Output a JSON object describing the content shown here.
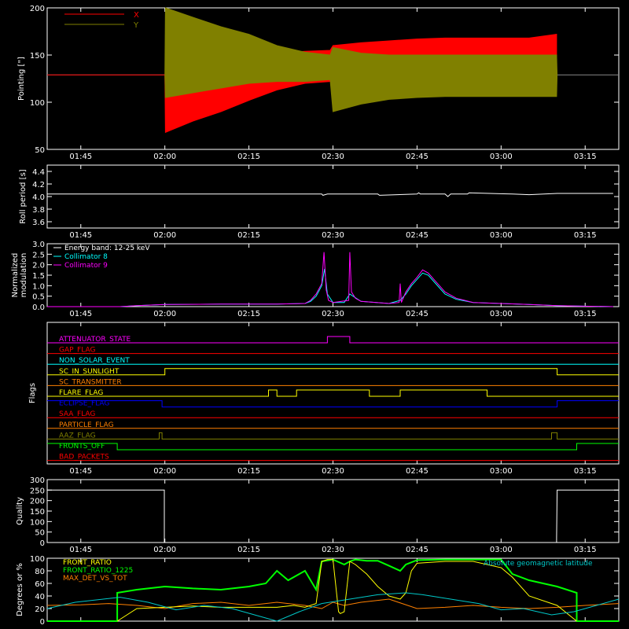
{
  "time_axis": {
    "ticks": [
      "01:45",
      "02:00",
      "02:15",
      "02:30",
      "02:45",
      "03:00",
      "03:15"
    ],
    "tick_minutes": [
      105,
      120,
      135,
      150,
      165,
      180,
      195
    ],
    "range_minutes": [
      99,
      201
    ]
  },
  "chart_data": [
    {
      "type": "area",
      "ylabel": "Pointing [\"]",
      "ylim": [
        50,
        200
      ],
      "yticks": [
        50,
        100,
        150,
        200
      ],
      "legend": {
        "placement": "top-left",
        "entries": [
          "X",
          "Y"
        ]
      },
      "series": [
        {
          "name": "X",
          "color": "#ff0000",
          "x": [
            99,
            120,
            120.1,
            125,
            130,
            135,
            140,
            145,
            149.5,
            150,
            155,
            160,
            165,
            170,
            175,
            180,
            185,
            189.9
          ],
          "min": [
            129,
            129,
            68,
            80,
            90,
            102,
            113,
            120,
            122,
            130,
            145,
            147,
            147,
            147,
            147,
            147,
            147,
            147
          ],
          "max": [
            129,
            129,
            128,
            135,
            142,
            148,
            152,
            154,
            155,
            160,
            163,
            165,
            167,
            168,
            168,
            168,
            168,
            172
          ]
        },
        {
          "name": "Y",
          "color": "#808000",
          "x": [
            120,
            120.1,
            125,
            130,
            135,
            140,
            145,
            149.5,
            150,
            155,
            160,
            165,
            170,
            175,
            180,
            185,
            189.9,
            190
          ],
          "min": [
            129,
            105,
            110,
            115,
            120,
            122,
            122,
            124,
            90,
            98,
            103,
            105,
            106,
            106,
            106,
            106,
            106,
            129
          ],
          "max": [
            129,
            200,
            190,
            180,
            172,
            160,
            153,
            150,
            158,
            152,
            150,
            150,
            150,
            150,
            150,
            150,
            150,
            129
          ]
        }
      ],
      "baseline": {
        "value": 129,
        "color": "#888888"
      }
    },
    {
      "type": "line",
      "ylabel": "Roll period [s]",
      "ylim": [
        3.5,
        4.5
      ],
      "yticks": [
        3.6,
        3.8,
        4.0,
        4.2,
        4.4
      ],
      "series": [
        {
          "color": "#ffffff",
          "x": [
            99,
            148,
            148.2,
            149,
            151,
            158,
            158.3,
            165,
            165.3,
            165.6,
            170,
            170.5,
            171,
            174,
            174.3,
            182,
            185,
            190,
            200
          ],
          "y": [
            4.04,
            4.04,
            4.02,
            4.04,
            4.04,
            4.04,
            4.02,
            4.04,
            4.06,
            4.04,
            4.04,
            4.0,
            4.04,
            4.04,
            4.06,
            4.04,
            4.03,
            4.05,
            4.05
          ]
        }
      ]
    },
    {
      "type": "line",
      "ylabel": "Normalized modulation",
      "ylim": [
        0,
        3.0
      ],
      "yticks": [
        0.0,
        0.5,
        1.0,
        1.5,
        2.0,
        2.5,
        3.0
      ],
      "legend": {
        "placement": "top-left",
        "entries": [
          "Energy band: 12-25 keV",
          "Collimator 8",
          "Collimator 9"
        ]
      },
      "series": [
        {
          "name": "Collimator 8",
          "color": "#00ffff",
          "x": [
            99,
            112,
            115,
            120,
            130,
            140,
            145,
            146,
            147,
            148,
            148.5,
            149,
            150,
            152,
            153,
            155,
            160,
            162,
            163,
            164,
            165,
            166,
            167,
            168,
            169,
            170,
            172,
            175,
            180,
            185,
            190,
            200
          ],
          "y": [
            0,
            0,
            0.05,
            0.1,
            0.12,
            0.12,
            0.15,
            0.25,
            0.5,
            1.0,
            1.8,
            0.6,
            0.2,
            0.2,
            0.6,
            0.25,
            0.15,
            0.3,
            0.6,
            1.0,
            1.3,
            1.6,
            1.5,
            1.2,
            0.9,
            0.6,
            0.35,
            0.2,
            0.15,
            0.1,
            0.05,
            0
          ]
        },
        {
          "name": "Collimator 9",
          "color": "#ff00ff",
          "x": [
            99,
            112,
            115,
            120,
            130,
            140,
            145,
            146,
            147,
            148,
            148.4,
            148.8,
            149.2,
            150,
            152.8,
            153,
            153.3,
            154,
            155,
            160,
            161.8,
            162,
            162.2,
            163,
            164,
            165,
            166,
            167,
            168,
            169,
            170,
            172,
            175,
            180,
            185,
            190,
            200
          ],
          "y": [
            0,
            0,
            0.05,
            0.1,
            0.12,
            0.12,
            0.15,
            0.3,
            0.6,
            1.1,
            2.6,
            0.8,
            0.3,
            0.2,
            0.3,
            2.6,
            0.7,
            0.4,
            0.25,
            0.15,
            0.2,
            1.1,
            0.2,
            0.7,
            1.1,
            1.4,
            1.75,
            1.6,
            1.3,
            1.0,
            0.7,
            0.4,
            0.2,
            0.15,
            0.1,
            0.05,
            0
          ]
        }
      ]
    },
    {
      "type": "line",
      "ylabel": "Flags",
      "series": [
        {
          "name": "ATTENUATOR_STATE",
          "color": "#ff00ff",
          "x": [
            99,
            149,
            149,
            153,
            153,
            201
          ],
          "y": [
            0,
            0,
            1,
            1,
            0,
            0
          ]
        },
        {
          "name": "GAP_FLAG",
          "color": "#ff0000",
          "x": [
            99,
            201
          ],
          "y": [
            0,
            0
          ]
        },
        {
          "name": "NON_SOLAR_EVENT",
          "color": "#00ffff",
          "x": [
            99,
            201
          ],
          "y": [
            0,
            0
          ]
        },
        {
          "name": "SC_IN_SUNLIGHT",
          "color": "#ffff00",
          "x": [
            99,
            120,
            120,
            190,
            190,
            201
          ],
          "y": [
            0,
            0,
            1,
            1,
            0,
            0
          ]
        },
        {
          "name": "SC_TRANSMITTER",
          "color": "#ff8000",
          "x": [
            99,
            201
          ],
          "y": [
            0,
            0
          ]
        },
        {
          "name": "FLARE_FLAG",
          "color": "#ffff00",
          "x": [
            99,
            138.5,
            138.5,
            140,
            140,
            143.5,
            143.5,
            156.5,
            156.5,
            162,
            162,
            177.5,
            177.5,
            201
          ],
          "y": [
            0,
            0,
            1,
            1,
            0,
            0,
            1,
            1,
            0,
            0,
            1,
            1,
            0,
            0
          ]
        },
        {
          "name": "ECLIPSE_FLAG",
          "color": "#0000ff",
          "x": [
            99,
            119.5,
            119.5,
            190,
            190,
            201
          ],
          "y": [
            1,
            1,
            0,
            0,
            1,
            1
          ]
        },
        {
          "name": "SAA_FLAG",
          "color": "#ff0000",
          "x": [
            99,
            201
          ],
          "y": [
            0,
            0
          ]
        },
        {
          "name": "PARTICLE_FLAG",
          "color": "#ff8000",
          "x": [
            99,
            201
          ],
          "y": [
            0,
            0
          ]
        },
        {
          "name": "AAZ_FLAG",
          "color": "#808000",
          "x": [
            99,
            119,
            119,
            119.5,
            119.5,
            189,
            189,
            190,
            190,
            201
          ],
          "y": [
            0,
            0,
            1,
            1,
            0,
            0,
            1,
            1,
            0,
            0
          ]
        },
        {
          "name": "FRONTS_OFF",
          "color": "#00ff00",
          "x": [
            99,
            111.5,
            111.5,
            193.5,
            193.5,
            201
          ],
          "y": [
            1,
            1,
            0,
            0,
            1,
            1
          ]
        },
        {
          "name": "BAD_PACKETS",
          "color": "#ff0000",
          "x": [
            99,
            201
          ],
          "y": [
            0,
            0
          ]
        }
      ]
    },
    {
      "type": "line",
      "ylabel": "Quality",
      "ylim": [
        0,
        300
      ],
      "yticks": [
        0,
        50,
        100,
        150,
        200,
        250,
        300
      ],
      "series": [
        {
          "color": "#ffffff",
          "x": [
            99,
            119.9,
            119.9,
            120,
            189.9,
            189.9,
            190,
            201
          ],
          "y": [
            250,
            250,
            0,
            0,
            0,
            20,
            250,
            250
          ]
        }
      ]
    },
    {
      "type": "line",
      "ylabel": "Degrees or %",
      "ylim": [
        0,
        100
      ],
      "yticks": [
        0,
        20,
        40,
        60,
        80,
        100
      ],
      "legend": {
        "placement": "top",
        "entries": [
          "FRONT_RATIO",
          "FRONT_RATIO_1225",
          "MAX_DET_VS_TOT",
          "Absolute geomagnetic latitude"
        ]
      },
      "series": [
        {
          "name": "FRONT_RATIO",
          "color": "#ffff00",
          "x": [
            111.5,
            115,
            120,
            125,
            130,
            135,
            140,
            143,
            145,
            147,
            148,
            149,
            150,
            151,
            151.3,
            152,
            153,
            154,
            156,
            158,
            160,
            162,
            163,
            164,
            165,
            170,
            175,
            180,
            182,
            185,
            190,
            193.5
          ],
          "y": [
            0,
            20,
            22,
            24,
            22,
            22,
            22,
            25,
            22,
            28,
            95,
            98,
            98,
            15,
            12,
            15,
            95,
            90,
            75,
            55,
            40,
            35,
            45,
            80,
            92,
            95,
            95,
            85,
            70,
            40,
            25,
            0
          ]
        },
        {
          "name": "FRONT_RATIO_1225",
          "color": "#00ff00",
          "x": [
            99,
            111.5,
            111.5,
            115,
            120,
            125,
            130,
            135,
            138,
            140,
            142,
            145,
            147,
            148,
            150,
            152,
            153,
            154,
            156,
            158,
            160,
            162,
            163,
            165,
            170,
            175,
            180,
            182,
            185,
            190,
            193.5,
            193.5,
            201
          ],
          "y": [
            0,
            0,
            45,
            50,
            55,
            52,
            50,
            55,
            60,
            80,
            65,
            80,
            50,
            95,
            98,
            90,
            95,
            98,
            96,
            96,
            88,
            80,
            90,
            97,
            98,
            98,
            98,
            75,
            65,
            55,
            45,
            0,
            0
          ]
        },
        {
          "name": "MAX_DET_VS_TOT",
          "color": "#ff8000",
          "x": [
            99,
            105,
            110,
            115,
            120,
            125,
            130,
            135,
            140,
            145,
            148,
            150,
            152,
            155,
            160,
            165,
            170,
            175,
            180,
            185,
            190,
            195,
            201
          ],
          "y": [
            25,
            26,
            28,
            25,
            20,
            28,
            30,
            25,
            30,
            25,
            20,
            30,
            25,
            30,
            35,
            20,
            22,
            25,
            22,
            20,
            22,
            25,
            28
          ]
        },
        {
          "name": "Absolute geomagnetic latitude",
          "color": "#00c8c8",
          "x": [
            99,
            104,
            109,
            112,
            117,
            122,
            127,
            132,
            136,
            140,
            144,
            148,
            153,
            158,
            163,
            166,
            171,
            176,
            180,
            184,
            189,
            193,
            197,
            201
          ],
          "y": [
            20,
            30,
            35,
            38,
            30,
            18,
            25,
            20,
            10,
            0,
            15,
            28,
            35,
            42,
            45,
            42,
            35,
            28,
            18,
            20,
            10,
            15,
            25,
            35
          ]
        }
      ]
    }
  ]
}
